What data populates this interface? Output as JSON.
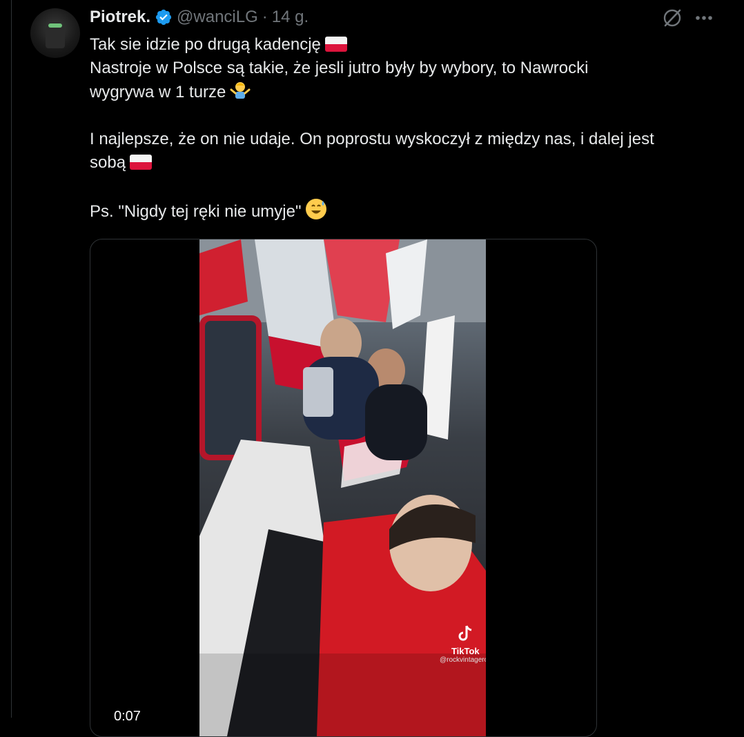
{
  "tweet": {
    "author_name": "Piotrek.",
    "author_handle": "@wanciLG",
    "separator": "·",
    "time": "14 g.",
    "verified": true,
    "lines": [
      "Tak sie idzie po drugą kadencję",
      "Nastroje w Polsce są takie, że jesli jutro były by wybory, to Nawrocki",
      "wygrywa w 1 turze",
      "I najlepsze, że on nie udaje. On poprostu wyskoczył z między nas, i dalej jest",
      "sobą",
      "Ps. \"Nigdy tej ręki nie umyje\""
    ]
  },
  "video": {
    "timestamp": "0:07",
    "watermark_brand": "TikTok",
    "watermark_handle": "@rockvintageroll"
  },
  "colors": {
    "background": "#000000",
    "text": "#e7e9ea",
    "muted": "#71767b",
    "verified": "#1d9bf0",
    "border": "#2f3336"
  },
  "icons": [
    "verified-badge-icon",
    "grok-icon",
    "more-icon",
    "flag-poland-icon",
    "shrug-emoji-icon",
    "grinning-sweat-emoji-icon"
  ]
}
